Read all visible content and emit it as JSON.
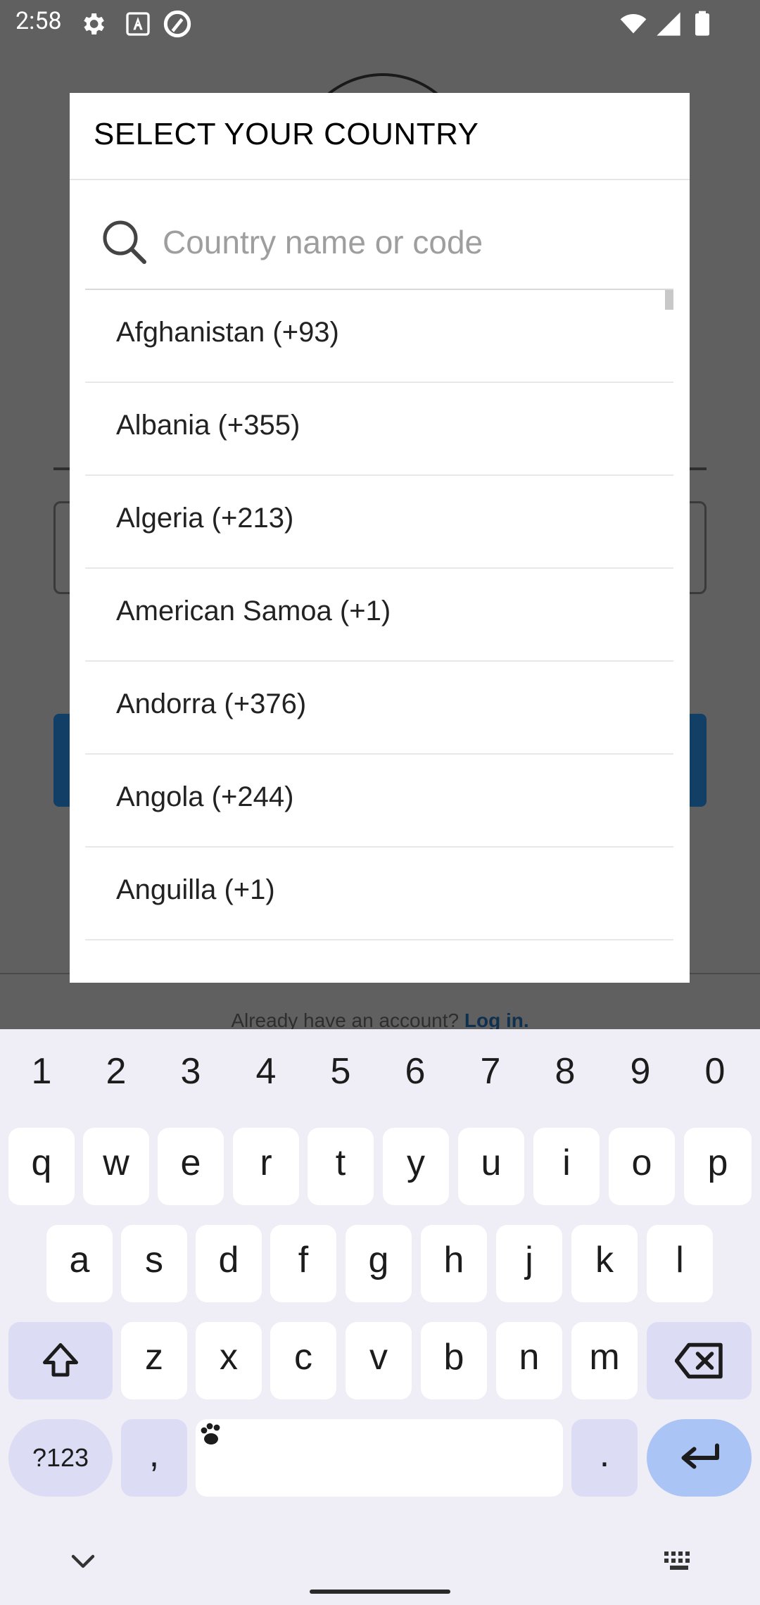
{
  "status_bar": {
    "time": "2:58",
    "left_icons": [
      "gear-icon",
      "text-a-icon",
      "app-logo-icon"
    ],
    "right_icons": [
      "wifi-icon",
      "signal-icon",
      "battery-icon"
    ]
  },
  "background": {
    "login_prompt": "Already have an account?",
    "login_link": "Log in."
  },
  "dialog": {
    "title": "SELECT YOUR COUNTRY",
    "search": {
      "placeholder": "Country name or code",
      "value": ""
    },
    "countries": [
      "Afghanistan (+93)",
      "Albania (+355)",
      "Algeria (+213)",
      "American Samoa (+1)",
      "Andorra (+376)",
      "Angola (+244)",
      "Anguilla (+1)"
    ]
  },
  "keyboard": {
    "number_row": [
      "1",
      "2",
      "3",
      "4",
      "5",
      "6",
      "7",
      "8",
      "9",
      "0"
    ],
    "row1": [
      "q",
      "w",
      "e",
      "r",
      "t",
      "y",
      "u",
      "i",
      "o",
      "p"
    ],
    "row2": [
      "a",
      "s",
      "d",
      "f",
      "g",
      "h",
      "j",
      "k",
      "l"
    ],
    "row3": [
      "z",
      "x",
      "c",
      "v",
      "b",
      "n",
      "m"
    ],
    "symbols_label": "?123",
    "comma": ",",
    "period": ".",
    "colors": {
      "background": "#efedf5",
      "special_key": "#dcddf5",
      "enter_key": "#a9c4f5"
    }
  }
}
